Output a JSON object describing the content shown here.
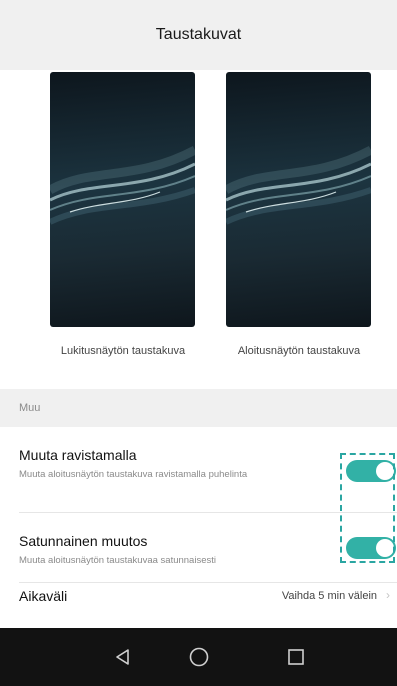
{
  "header": {
    "title": "Taustakuvat"
  },
  "wallpapers": {
    "lock_label": "Lukitusnäytön taustakuva",
    "home_label": "Aloitusnäytön taustakuva"
  },
  "sections": {
    "other": "Muu"
  },
  "settings": {
    "shake": {
      "title": "Muuta ravistamalla",
      "subtitle": "Muuta aloitusnäytön taustakuva ravistamalla puhelinta",
      "enabled": true
    },
    "random": {
      "title": "Satunnainen muutos",
      "subtitle": "Muuta aloitusnäytön taustakuvaa satunnaisesti",
      "enabled": true
    },
    "interval": {
      "title": "Aikaväli",
      "value": "Vaihda 5 min välein"
    }
  },
  "colors": {
    "accent": "#32b1a6",
    "highlight": "#2aa6a2",
    "navbar": "#121212"
  },
  "icons": {
    "back": "back-triangle-icon",
    "home": "home-circle-icon",
    "recents": "recents-square-icon"
  }
}
